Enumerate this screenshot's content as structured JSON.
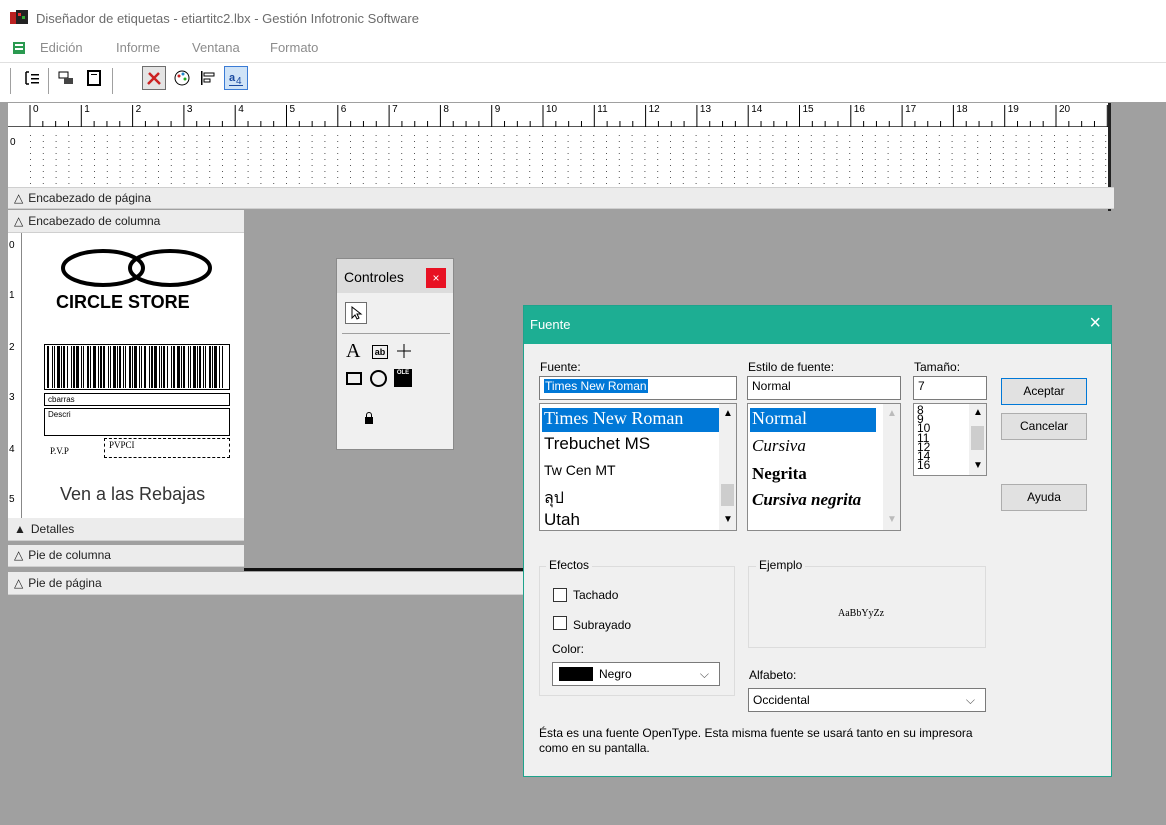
{
  "window": {
    "title": "Diseñador de etiquetas - etiartitc2.lbx - Gestión Infotronic Software"
  },
  "menu": {
    "items": [
      "Edición",
      "Informe",
      "Ventana",
      "Formato"
    ]
  },
  "ruler": {
    "ticks": [
      "0",
      "1",
      "2",
      "3",
      "4",
      "5",
      "6",
      "7",
      "8",
      "9",
      "10",
      "11",
      "12",
      "13",
      "14",
      "15",
      "16",
      "17",
      "18",
      "19",
      "20"
    ],
    "vticks": [
      "0",
      "1",
      "2",
      "3",
      "4",
      "5"
    ]
  },
  "bands": {
    "page_header": "Encabezado de página",
    "column_header": "Encabezado de columna",
    "details": "Detalles",
    "column_footer": "Pie de columna",
    "page_footer": "Pie de página"
  },
  "label_design": {
    "store_name": "CIRCLE STORE",
    "barcode_field": "cbarras",
    "descr_field": "Descri",
    "pvp_label": "P.V.P",
    "pvp_field": "PVPCI",
    "slogan": "Ven a las Rebajas"
  },
  "controls_palette": {
    "title": "Controles"
  },
  "font_dialog": {
    "title": "Fuente",
    "font_label": "Fuente:",
    "font_value": "Times New Roman",
    "fonts": [
      "Times New Roman",
      "Trebuchet MS",
      "Tw Cen MT",
      "ลุป",
      "Utah"
    ],
    "style_label": "Estilo de fuente:",
    "style_value": "Normal",
    "styles": [
      "Normal",
      "Cursiva",
      "Negrita",
      "Cursiva negrita"
    ],
    "size_label": "Tamaño:",
    "size_value": "7",
    "sizes": [
      "8",
      "9",
      "10",
      "11",
      "12",
      "14",
      "16"
    ],
    "accept_button": "Aceptar",
    "cancel_button": "Cancelar",
    "help_button": "Ayuda",
    "effects_label": "Efectos",
    "strike_label": "Tachado",
    "underline_label": "Subrayado",
    "color_label": "Color:",
    "color_value": "Negro",
    "sample_label": "Ejemplo",
    "sample_text": "AaBbYyZz",
    "script_label": "Alfabeto:",
    "script_value": "Occidental",
    "info_text": "Ésta es una fuente OpenType. Esta misma fuente se usará tanto en su impresora como en su pantalla."
  },
  "colors": {
    "dialog_accent": "#1dae93",
    "selection": "#0078d7",
    "close_red": "#e81123"
  }
}
